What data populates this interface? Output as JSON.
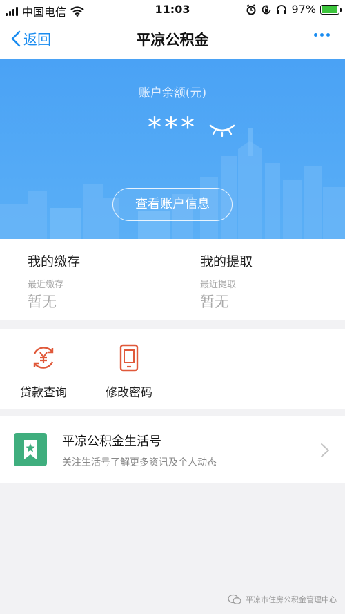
{
  "status_bar": {
    "carrier": "中国电信",
    "time": "11:03",
    "battery": "97%",
    "battery_level": 0.97
  },
  "nav": {
    "back_label": "返回",
    "title": "平凉公积金",
    "more_icon": "more-dots-icon"
  },
  "account": {
    "balance_label": "账户余额(元)",
    "balance_masked": "***",
    "view_info_button": "查看账户信息"
  },
  "records": {
    "deposit": {
      "title": "我的缴存",
      "sub_label": "最近缴存",
      "value": "暂无"
    },
    "withdraw": {
      "title": "我的提取",
      "sub_label": "最近提取",
      "value": "暂无"
    }
  },
  "services": [
    {
      "label": "贷款查询",
      "icon": "loan-yuan-icon"
    },
    {
      "label": "修改密码",
      "icon": "phone-password-icon"
    }
  ],
  "life_account": {
    "title": "平凉公积金生活号",
    "subtitle": "关注生活号了解更多资讯及个人动态"
  },
  "watermark": {
    "text": "平凉市住房公积金管理中心"
  },
  "colors": {
    "accent": "#1a8cf0",
    "hero": "#4aa2f5",
    "service_icon": "#e0593a",
    "life_icon": "#3fae7e"
  }
}
